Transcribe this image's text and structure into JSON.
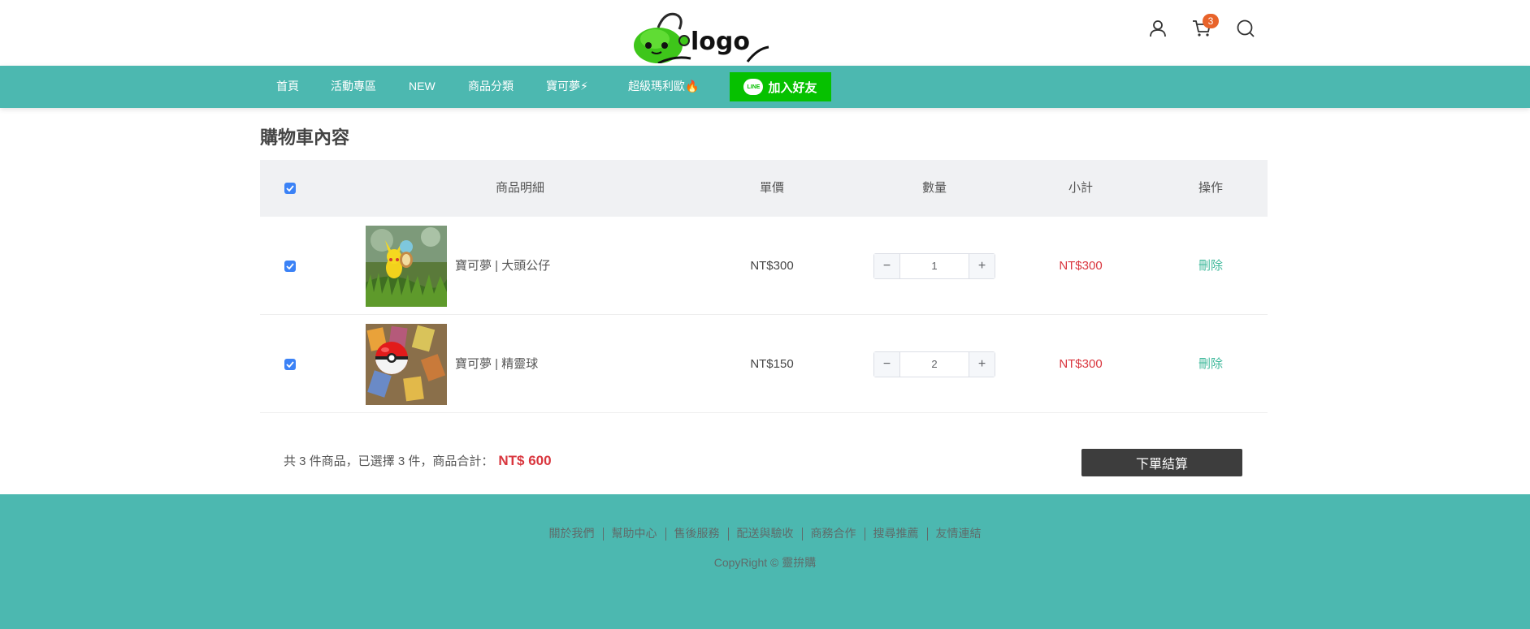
{
  "header": {
    "logo_text": "logo",
    "cart_badge": "3"
  },
  "nav": {
    "items": [
      "首頁",
      "活動專區",
      "NEW",
      "商品分類",
      "寶可夢⚡",
      "超級瑪利歐🔥"
    ],
    "line_logo": "LINE",
    "line_button": "加入好友"
  },
  "cart": {
    "title": "購物車內容",
    "columns": {
      "details": "商品明細",
      "unit_price": "單價",
      "quantity": "數量",
      "subtotal": "小計",
      "actions": "操作"
    },
    "items": [
      {
        "name": "寶可夢 | 大頭公仔",
        "price": "NT$300",
        "qty": "1",
        "subtotal": "NT$300",
        "action": "刪除",
        "checked": true
      },
      {
        "name": "寶可夢 | 精靈球",
        "price": "NT$150",
        "qty": "2",
        "subtotal": "NT$300",
        "action": "刪除",
        "checked": true
      }
    ],
    "qty_minus": "−",
    "qty_plus": "+",
    "summary_text": "共 3 件商品，已選擇 3 件，商品合計：",
    "total": "NT$ 600",
    "checkout_button": "下單結算"
  },
  "footer": {
    "links": [
      "關於我們",
      "幫助中心",
      "售後服務",
      "配送與驗收",
      "商務合作",
      "搜尋推薦",
      "友情連結"
    ],
    "copyright": "CopyRight © 靈拚購"
  },
  "colors": {
    "teal": "#4cb8b0",
    "line_green": "#06c100",
    "price_red": "#d9363e",
    "delete_green": "#3db89a",
    "checkbox_blue": "#3b82f6"
  }
}
